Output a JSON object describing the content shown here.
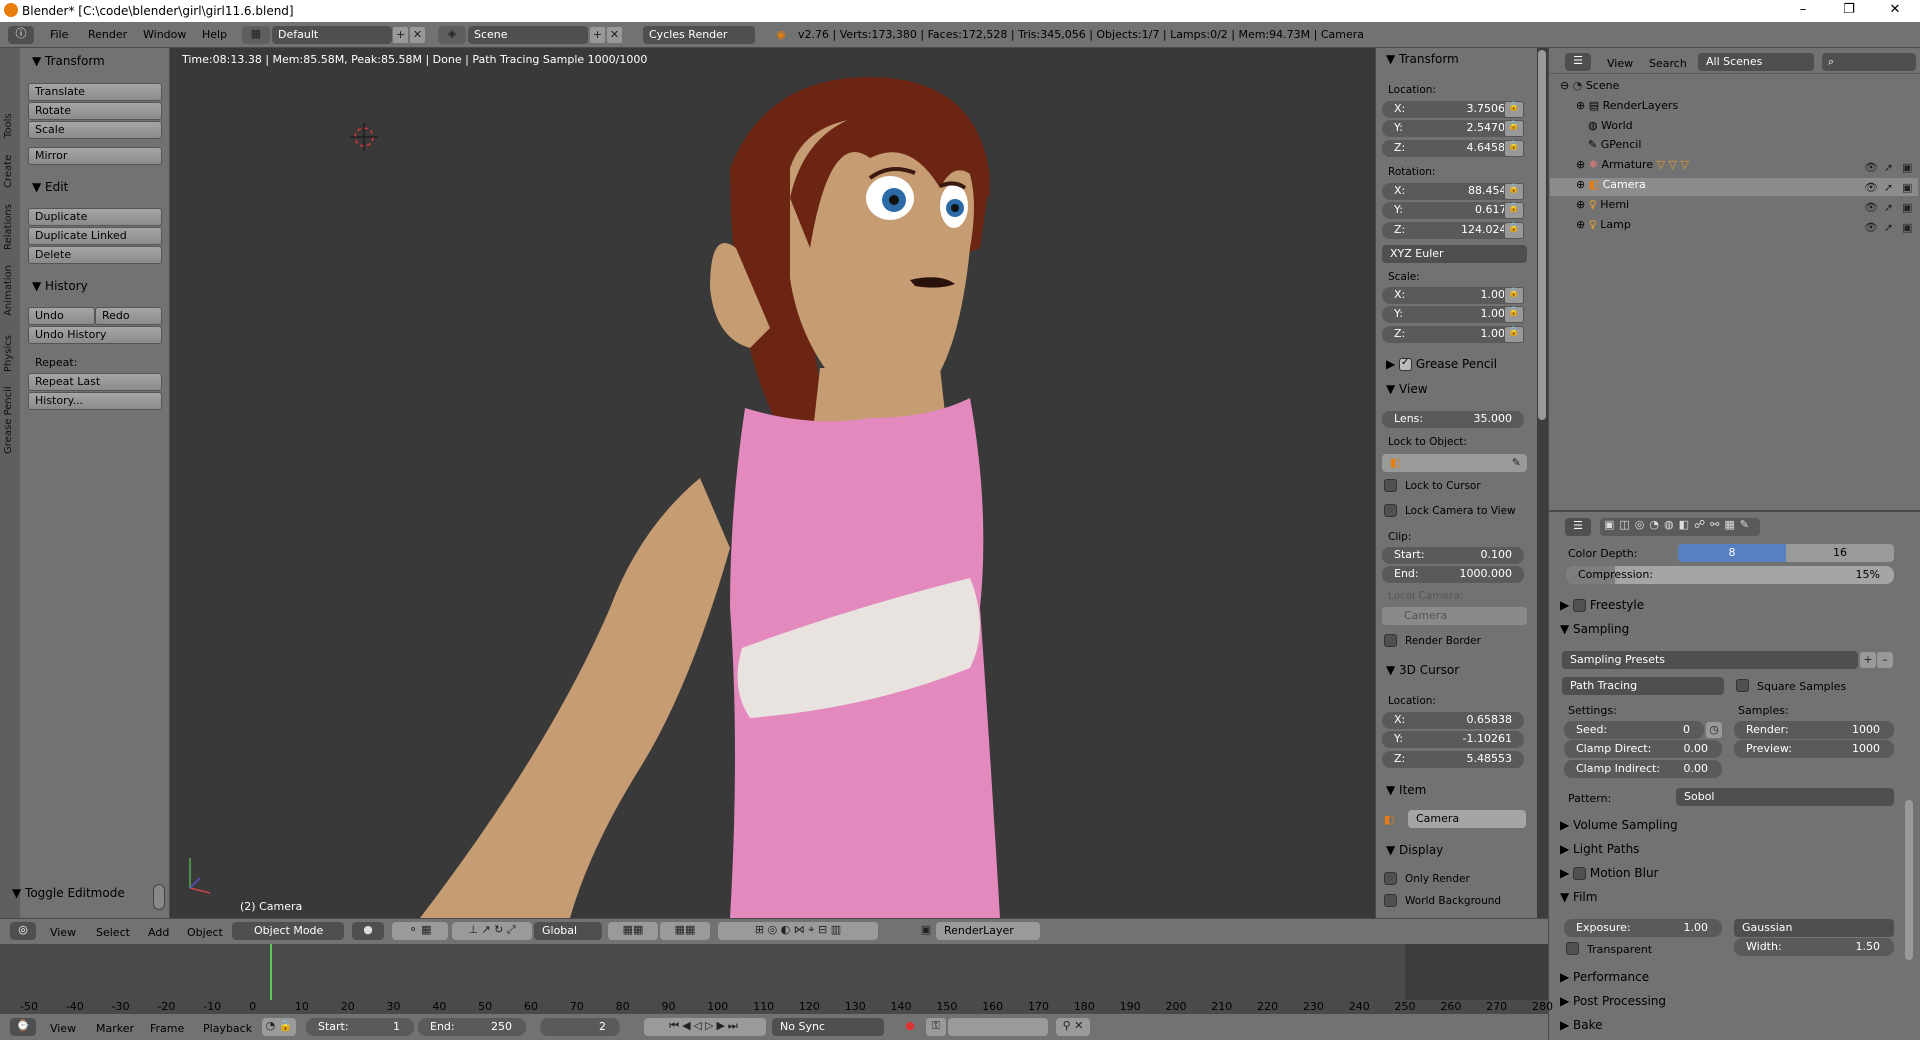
{
  "window": {
    "title": "Blender* [C:\\code\\blender\\girl\\girl11.6.blend]"
  },
  "info": {
    "menus": [
      "File",
      "Render",
      "Window",
      "Help"
    ],
    "layout": "Default",
    "scene": "Scene",
    "engine": "Cycles Render",
    "stats": "v2.76 | Verts:173,380 | Faces:172,528 | Tris:345,056 | Objects:1/7 | Lamps:0/2 | Mem:94.73M | Camera"
  },
  "toolshelf": {
    "vtabs": [
      "Tools",
      "Create",
      "Relations",
      "Animation",
      "Physics",
      "Grease Pencil"
    ],
    "transform_header": "Transform",
    "transform_buttons": [
      "Translate",
      "Rotate",
      "Scale"
    ],
    "mirror": "Mirror",
    "edit_header": "Edit",
    "edit_buttons": [
      "Duplicate",
      "Duplicate Linked",
      "Delete"
    ],
    "history_header": "History",
    "undo": "Undo",
    "redo": "Redo",
    "undo_history": "Undo History",
    "repeat_label": "Repeat:",
    "repeat_last": "Repeat Last",
    "history_btn": "History...",
    "toggle_editmode": "Toggle Editmode"
  },
  "viewport": {
    "status": "Time:08:13.38 | Mem:85.58M, Peak:85.58M | Done | Path Tracing Sample 1000/1000",
    "object_label": "(2) Camera"
  },
  "npanel": {
    "transform_header": "Transform",
    "location_label": "Location:",
    "location": [
      {
        "axis": "X:",
        "value": "3.75065"
      },
      {
        "axis": "Y:",
        "value": "2.54702"
      },
      {
        "axis": "Z:",
        "value": "4.64585"
      }
    ],
    "rotation_label": "Rotation:",
    "rotation": [
      {
        "axis": "X:",
        "value": "88.454°"
      },
      {
        "axis": "Y:",
        "value": "0.617°"
      },
      {
        "axis": "Z:",
        "value": "124.024°"
      }
    ],
    "rotation_mode": "XYZ Euler",
    "scale_label": "Scale:",
    "scale": [
      {
        "axis": "X:",
        "value": "1.000"
      },
      {
        "axis": "Y:",
        "value": "1.000"
      },
      {
        "axis": "Z:",
        "value": "1.000"
      }
    ],
    "grease_pencil": "Grease Pencil",
    "view_header": "View",
    "lens_label": "Lens:",
    "lens_value": "35.000",
    "lock_to_object": "Lock to Object:",
    "lock_to_cursor": "Lock to Cursor",
    "lock_camera_to_view": "Lock Camera to View",
    "clip_label": "Clip:",
    "clip_start_label": "Start:",
    "clip_start": "0.100",
    "clip_end_label": "End:",
    "clip_end": "1000.000",
    "local_camera_label": "Local Camera:",
    "local_camera": "Camera",
    "render_border": "Render Border",
    "cursor_header": "3D Cursor",
    "cursor_location_label": "Location:",
    "cursor_location": [
      {
        "axis": "X:",
        "value": "0.65838"
      },
      {
        "axis": "Y:",
        "value": "-1.10261"
      },
      {
        "axis": "Z:",
        "value": "5.48553"
      }
    ],
    "item_header": "Item",
    "item_name": "Camera",
    "display_header": "Display",
    "only_render": "Only Render",
    "world_background": "World Background"
  },
  "outliner": {
    "view": "View",
    "search": "Search",
    "scenes": "All Scenes",
    "rows": [
      "Scene",
      "RenderLayers",
      "World",
      "GPencil",
      "Armature",
      "Camera",
      "Hemi",
      "Lamp"
    ]
  },
  "properties": {
    "color_depth_label": "Color Depth:",
    "color_depth_8": "8",
    "color_depth_16": "16",
    "compression_label": "Compression:",
    "compression_value": "15%",
    "compression_fraction": 0.15,
    "freestyle": "Freestyle",
    "sampling": "Sampling",
    "sampling_presets": "Sampling Presets",
    "integrator": "Path Tracing",
    "square_samples": "Square Samples",
    "settings_label": "Settings:",
    "samples_label": "Samples:",
    "seed_label": "Seed:",
    "seed_value": "0",
    "clamp_direct_label": "Clamp Direct:",
    "clamp_direct": "0.00",
    "clamp_indirect_label": "Clamp Indirect:",
    "clamp_indirect": "0.00",
    "render_label": "Render:",
    "render_samples": "1000",
    "preview_label": "Preview:",
    "preview_samples": "1000",
    "pattern_label": "Pattern:",
    "pattern_value": "Sobol",
    "volume_sampling": "Volume Sampling",
    "light_paths": "Light Paths",
    "motion_blur": "Motion Blur",
    "film": "Film",
    "exposure_label": "Exposure:",
    "exposure": "1.00",
    "filter": "Gaussian",
    "transparent": "Transparent",
    "width_label": "Width:",
    "width": "1.50",
    "performance": "Performance",
    "post_processing": "Post Processing",
    "bake": "Bake"
  },
  "vpheader": {
    "menus": [
      "View",
      "Select",
      "Add",
      "Object"
    ],
    "mode": "Object Mode",
    "orientation": "Global",
    "render_layer": "RenderLayer"
  },
  "timeline": {
    "ticks": [
      "-50",
      "-40",
      "-30",
      "-20",
      "-10",
      "0",
      "10",
      "20",
      "30",
      "40",
      "50",
      "60",
      "70",
      "80",
      "90",
      "100",
      "110",
      "120",
      "130",
      "140",
      "150",
      "160",
      "170",
      "180",
      "190",
      "200",
      "210",
      "220",
      "230",
      "240",
      "250",
      "260",
      "270",
      "280"
    ],
    "menus": [
      "View",
      "Marker",
      "Frame",
      "Playback"
    ],
    "start_label": "Start:",
    "start": "1",
    "end_label": "End:",
    "end": "250",
    "current": "2",
    "sync": "No Sync"
  },
  "colors": {
    "accent": "#5680c2",
    "viewport": "#393939",
    "panel": "#727272"
  }
}
